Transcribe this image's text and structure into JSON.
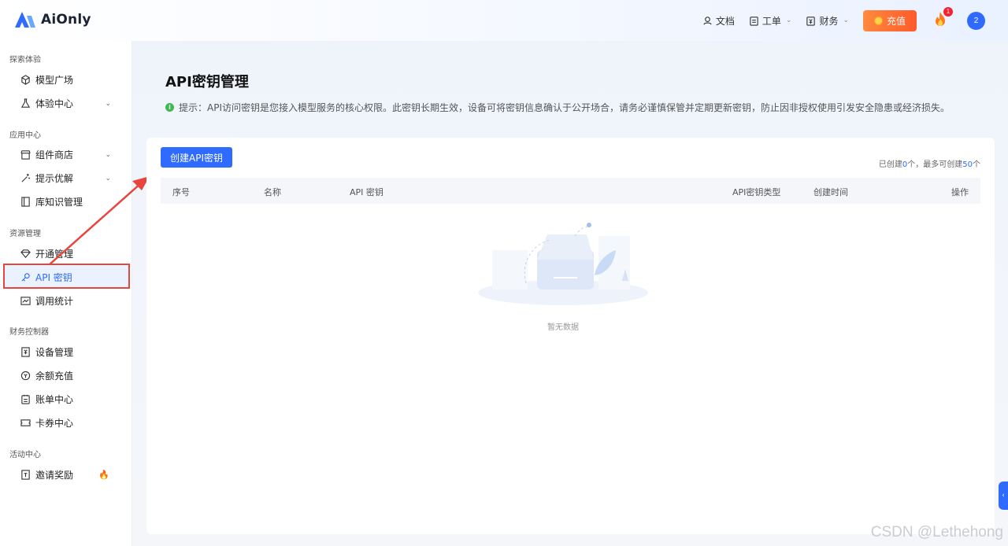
{
  "app": {
    "name": "AiOnly"
  },
  "header": {
    "docs": "文档",
    "ticket": "工单",
    "finance": "财务",
    "recharge": "充值",
    "notify_count": "1",
    "avatar": "2"
  },
  "sidebar": {
    "groups": [
      {
        "title": "探索体验",
        "items": [
          {
            "label": "模型广场"
          },
          {
            "label": "体验中心"
          }
        ]
      },
      {
        "title": "应用中心",
        "items": [
          {
            "label": "组件商店"
          },
          {
            "label": "提示优解"
          },
          {
            "label": "库知识管理"
          }
        ]
      },
      {
        "title": "资源管理",
        "items": [
          {
            "label": "开通管理"
          },
          {
            "label": "API 密钥"
          },
          {
            "label": "调用统计"
          }
        ]
      },
      {
        "title": "财务控制器",
        "items": [
          {
            "label": "设备管理"
          },
          {
            "label": "余额充值"
          },
          {
            "label": "账单中心"
          },
          {
            "label": "卡券中心"
          }
        ]
      },
      {
        "title": "活动中心",
        "items": [
          {
            "label": "邀请奖励"
          }
        ]
      }
    ]
  },
  "main": {
    "title": "API密钥管理",
    "notice": "提示：API访问密钥是您接入模型服务的核心权限。此密钥长期生效，设备可将密钥信息确认于公开场合，请务必谨慎保管并定期更新密钥，防止因非授权使用引发安全隐患或经济损失。",
    "create_button": "创建API密钥",
    "quota": {
      "prefix": "已创建",
      "created": "0",
      "mid": "个，最多可创建",
      "max": "50",
      "suffix": "个"
    },
    "table": {
      "columns": [
        "序号",
        "名称",
        "API 密钥",
        "API密钥类型",
        "创建时间",
        "操作"
      ]
    },
    "empty_text": "暂无数据"
  },
  "watermark": "CSDN @Lethehong",
  "colors": {
    "accent": "#2f6bff",
    "highlight": "#e8453c",
    "recharge": "#ff6a2d"
  }
}
